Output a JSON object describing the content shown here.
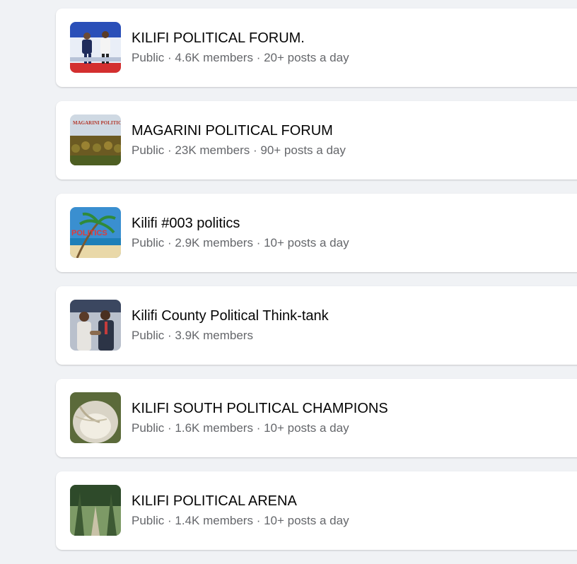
{
  "groups": [
    {
      "name": "KILIFI POLITICAL FORUM.",
      "privacy": "Public",
      "members": "4.6K members",
      "activity": "20+ posts a day",
      "thumb_icon": "political-forum-photo",
      "thumb_colors": [
        "#2a4fb8",
        "#d32f2f",
        "#f4f4f4"
      ]
    },
    {
      "name": "MAGARINI POLITICAL FORUM",
      "privacy": "Public",
      "members": "23K members",
      "activity": "90+ posts a day",
      "thumb_icon": "pineapple-field-photo",
      "thumb_colors": [
        "#cfd9e3",
        "#7d6a2a",
        "#4d5e22"
      ],
      "thumb_text": "MAGARINI POLITICAL FORUM"
    },
    {
      "name": "Kilifi #003 politics",
      "privacy": "Public",
      "members": "2.9K members",
      "activity": "10+ posts a day",
      "thumb_icon": "beach-palm-photo",
      "thumb_colors": [
        "#3a8fd0",
        "#e9d8a8",
        "#2f8a3b"
      ],
      "thumb_text": "POLITICS"
    },
    {
      "name": "Kilifi County Political Think-tank",
      "privacy": "Public",
      "members": "3.9K members",
      "activity": "",
      "thumb_icon": "politicians-photo",
      "thumb_colors": [
        "#3b4760",
        "#e6e4e0",
        "#8a6b4f"
      ]
    },
    {
      "name": "KILIFI SOUTH POLITICAL CHAMPIONS",
      "privacy": "Public",
      "members": "1.6K members",
      "activity": "10+ posts a day",
      "thumb_icon": "coconut-photo",
      "thumb_colors": [
        "#d9d4c6",
        "#b7ad92",
        "#5b6a3a"
      ]
    },
    {
      "name": "KILIFI POLITICAL ARENA",
      "privacy": "Public",
      "members": "1.4K members",
      "activity": "10+ posts a day",
      "thumb_icon": "forest-path-photo",
      "thumb_colors": [
        "#5f7a4c",
        "#c9c2a8",
        "#2e4a2a"
      ]
    }
  ],
  "separator": " · "
}
